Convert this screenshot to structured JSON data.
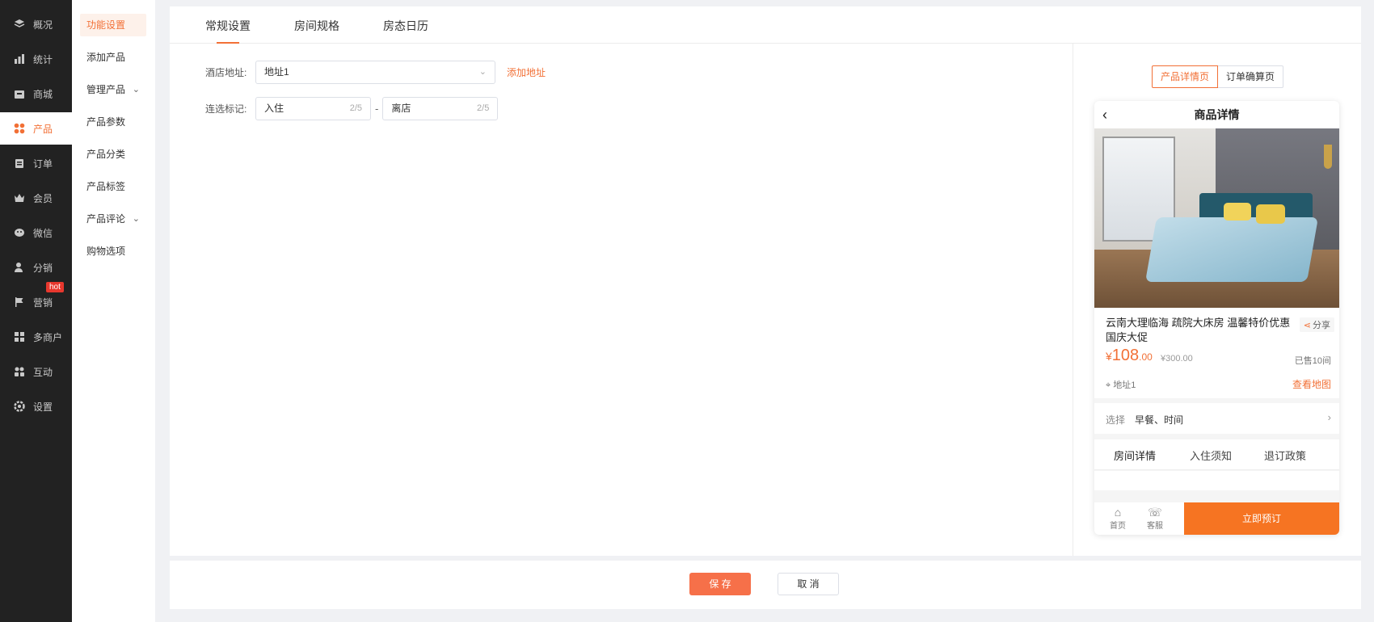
{
  "nav": {
    "items": [
      {
        "label": "概况",
        "icon": "layers-icon"
      },
      {
        "label": "统计",
        "icon": "chart-icon"
      },
      {
        "label": "商城",
        "icon": "store-icon"
      },
      {
        "label": "产品",
        "icon": "apps-icon"
      },
      {
        "label": "订单",
        "icon": "clipboard-icon"
      },
      {
        "label": "会员",
        "icon": "crown-icon"
      },
      {
        "label": "微信",
        "icon": "wechat-icon"
      },
      {
        "label": "分销",
        "icon": "user-share-icon"
      },
      {
        "label": "营销",
        "icon": "flag-icon"
      },
      {
        "label": "多商户",
        "icon": "merchant-icon"
      },
      {
        "label": "互动",
        "icon": "interact-icon"
      },
      {
        "label": "设置",
        "icon": "gear-icon"
      }
    ],
    "hot_badge": "hot",
    "accent": "#f27036"
  },
  "subnav": {
    "items": [
      {
        "label": "功能设置"
      },
      {
        "label": "添加产品"
      },
      {
        "label": "管理产品"
      },
      {
        "label": "产品参数"
      },
      {
        "label": "产品分类"
      },
      {
        "label": "产品标签"
      },
      {
        "label": "产品评论"
      },
      {
        "label": "购物选项"
      }
    ]
  },
  "tabs": [
    "常规设置",
    "房间规格",
    "房态日历"
  ],
  "form": {
    "address_label": "酒店地址:",
    "address_value": "地址1",
    "add_address_link": "添加地址",
    "tag_label": "连选标记:",
    "checkin_value": "入住",
    "checkin_count": "2/5",
    "checkout_value": "离店",
    "checkout_count": "2/5",
    "dash": "-"
  },
  "preview": {
    "seg_left": "产品详情页",
    "seg_right": "订单确算页",
    "phone": {
      "header_title": "商品详情",
      "product_title": "云南大理临海 疏院大床房 温馨特价优惠 国庆大促",
      "share_label": "分享",
      "price_symbol": "¥",
      "price_int": "108",
      "price_dec": ".00",
      "orig_price": "¥300.00",
      "sold": "已售10间",
      "address": "地址1",
      "map_link": "查看地图",
      "choose_label": "选择",
      "choose_value": "早餐、时间",
      "tabs": [
        "房间详情",
        "入住须知",
        "退订政策"
      ],
      "footer_home": "首页",
      "footer_service": "客服",
      "book_button": "立即预订"
    }
  },
  "footer": {
    "save_label": "保 存",
    "cancel_label": "取 消"
  }
}
